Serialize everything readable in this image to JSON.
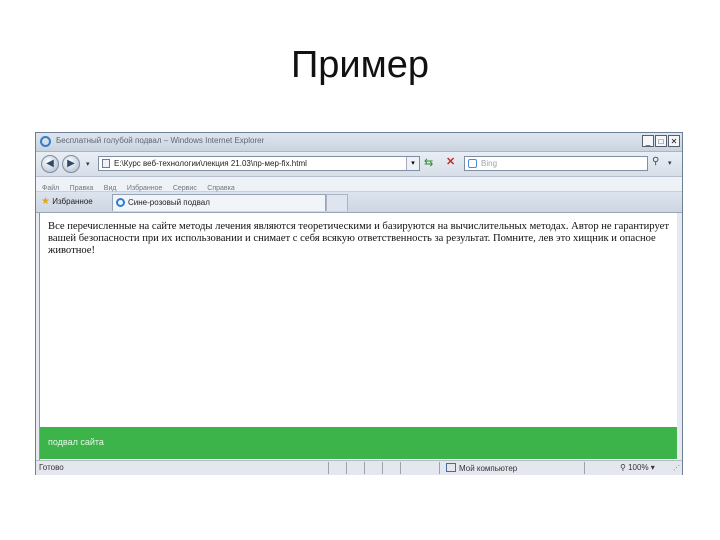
{
  "slide": {
    "title": "Пример"
  },
  "window": {
    "title": "Бесплатный голубой подвал – Windows Internet Explorer",
    "controls": {
      "minimize": "_",
      "maximize": "□",
      "close": "✕"
    }
  },
  "address_bar": {
    "url": "E:\\Курс веб-технологии\\лекция 21.03\\пр-мер-fix.html",
    "search_placeholder": "Bing"
  },
  "menu": {
    "items": [
      "Файл",
      "Правка",
      "Вид",
      "Избранное",
      "Сервис",
      "Справка"
    ]
  },
  "tabs": {
    "favorites_label": "Избранное",
    "items": [
      {
        "label": "Сине-розовый подвал"
      }
    ]
  },
  "page": {
    "text": "Все перечисленные на сайте методы лечения являются теоретическими и базируются на вычислительных методах. Автор не гарантирует вашей безопасности при их использовании и снимает с себя всякую ответственность за результат. Помните, лев это хищник и опасное животное!",
    "footer_text": "подвал сайта"
  },
  "status_bar": {
    "ready": "Готово",
    "zone": "Мой компьютер",
    "zoom": "100%"
  },
  "colors": {
    "footer_bg": "#3cb44a",
    "accent": "#2f7fd1"
  }
}
